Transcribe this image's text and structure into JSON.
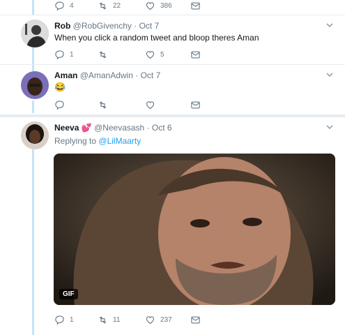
{
  "top_actions": {
    "reply": "4",
    "retweet": "22",
    "like": "386"
  },
  "tweets": [
    {
      "name": "Rob",
      "handle": "@RobGivenchy",
      "sep": "·",
      "date": "Oct 7",
      "text": "When you click a random tweet and bloop theres Aman",
      "reply_count": "1",
      "retweet_count": "",
      "like_count": "5"
    },
    {
      "name": "Aman",
      "handle": "@AmanAdwin",
      "sep": "·",
      "date": "Oct 7",
      "text": "😂"
    },
    {
      "name": "Neeva",
      "name_emoji": "💕",
      "handle": "@Neevasash",
      "sep": "·",
      "date": "Oct 6",
      "replying_prefix": "Replying to",
      "replying_to": "@LilMaarty",
      "media_badge": "GIF",
      "reply_count": "1",
      "retweet_count": "11",
      "like_count": "237"
    }
  ]
}
